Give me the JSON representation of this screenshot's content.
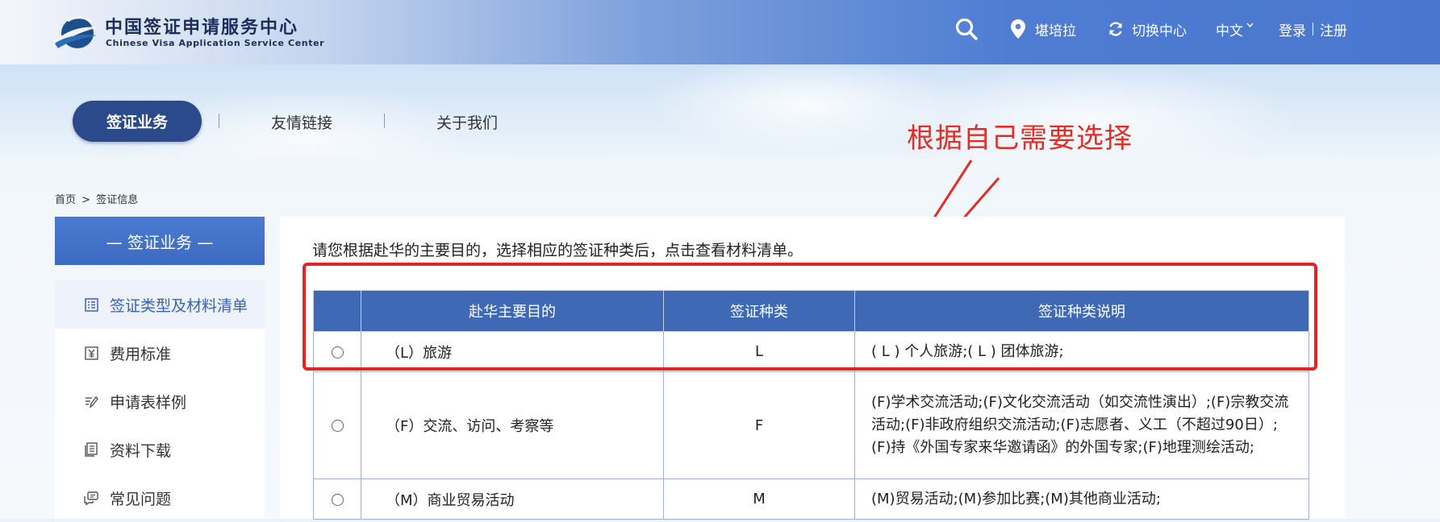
{
  "header": {
    "logo_cn": "中国签证申请服务中心",
    "logo_en": "Chinese Visa Application Service Center",
    "location": "堪培拉",
    "switch_center": "切换中心",
    "language": "中文",
    "login": "登录",
    "register": "注册"
  },
  "nav": {
    "items": [
      {
        "label": "签证业务",
        "active": true
      },
      {
        "label": "友情链接"
      },
      {
        "label": "关于我们"
      }
    ]
  },
  "annotation": {
    "text": "根据自己需要选择",
    "color": "#e42d24"
  },
  "breadcrumb": {
    "home": "首页",
    "separator": ">",
    "current": "签证信息"
  },
  "sidebar": {
    "title": "— 签证业务 —",
    "items": [
      {
        "label": "签证类型及材料清单",
        "icon": "checklist-icon",
        "active": true
      },
      {
        "label": "费用标准",
        "icon": "yen-icon"
      },
      {
        "label": "申请表样例",
        "icon": "form-sample-icon"
      },
      {
        "label": "资料下载",
        "icon": "download-doc-icon"
      },
      {
        "label": "常见问题",
        "icon": "faq-icon"
      }
    ]
  },
  "main": {
    "intro": "请您根据赴华的主要目的，选择相应的签证种类后，点击查看材料清单。",
    "table": {
      "headers": [
        "",
        "赴华主要目的",
        "签证种类",
        "签证种类说明"
      ],
      "rows": [
        {
          "purpose": "（L）旅游",
          "type": "L",
          "desc": "( L ) 个人旅游;( L ) 团体旅游;"
        },
        {
          "purpose": "（F）交流、访问、考察等",
          "type": "F",
          "desc": "(F)学术交流活动;(F)文化交流活动（如交流性演出）;(F)宗教交流活动;(F)非政府组织交流活动;(F)志愿者、义工（不超过90日）;(F)持《外国专家来华邀请函》的外国专家;(F)地理测绘活动;"
        },
        {
          "purpose": "（M）商业贸易活动",
          "type": "M",
          "desc": "(M)贸易活动;(M)参加比赛;(M)其他商业活动;"
        }
      ]
    }
  },
  "colors": {
    "brand_dark": "#2b4a8b",
    "header_blue": "#3f68b5",
    "highlight_red": "#e42323"
  }
}
